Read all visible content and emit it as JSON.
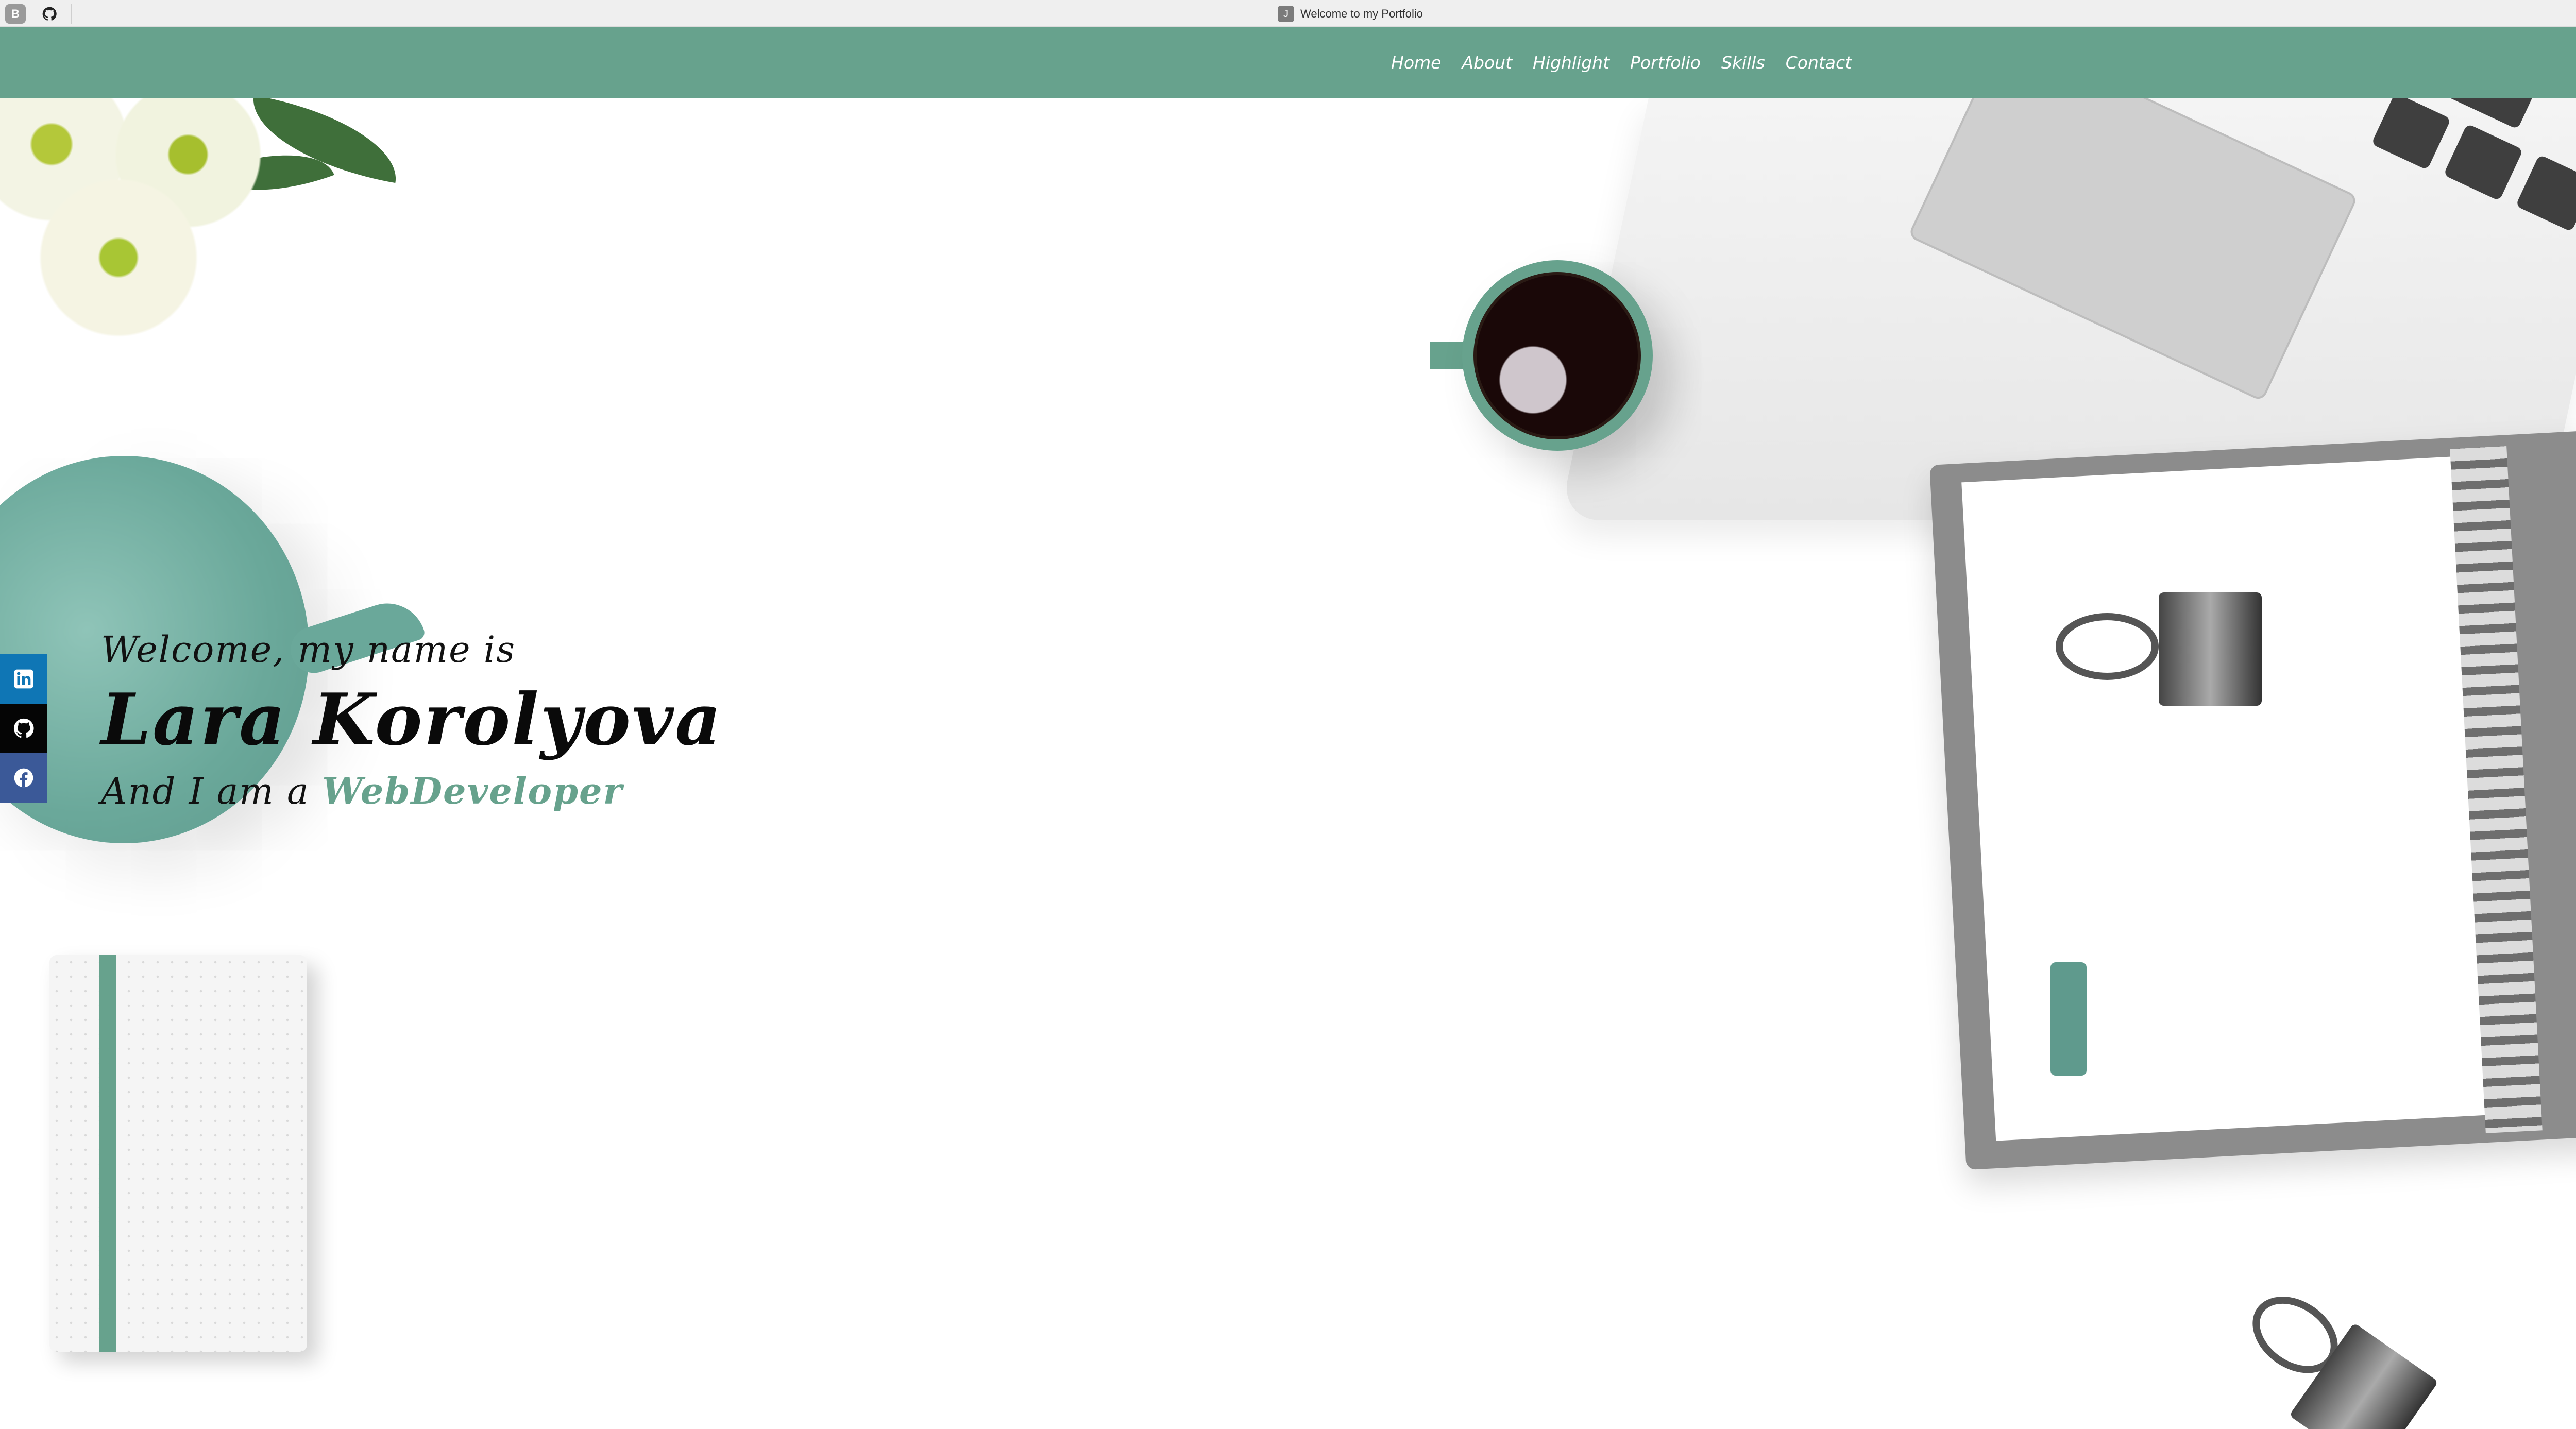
{
  "browser": {
    "tab_title": "Welcome to my Portfolio",
    "tab_favicon_letter": "J",
    "bookmark_letter": "B"
  },
  "nav": {
    "items": [
      {
        "label": "Home"
      },
      {
        "label": "About"
      },
      {
        "label": "Highlight"
      },
      {
        "label": "Portfolio"
      },
      {
        "label": "Skills"
      },
      {
        "label": "Contact"
      }
    ]
  },
  "hero": {
    "intro": "Welcome, my name is",
    "name": "Lara Korolyova",
    "role_prefix": "And I am a ",
    "role_highlight": "WebDeveloper"
  },
  "social": [
    {
      "name": "linkedin-icon"
    },
    {
      "name": "github-icon"
    },
    {
      "name": "facebook-icon"
    }
  ],
  "colors": {
    "accent": "#67a28d",
    "linkedin": "#0f76b5",
    "github": "#050505",
    "facebook": "#3b5998"
  }
}
